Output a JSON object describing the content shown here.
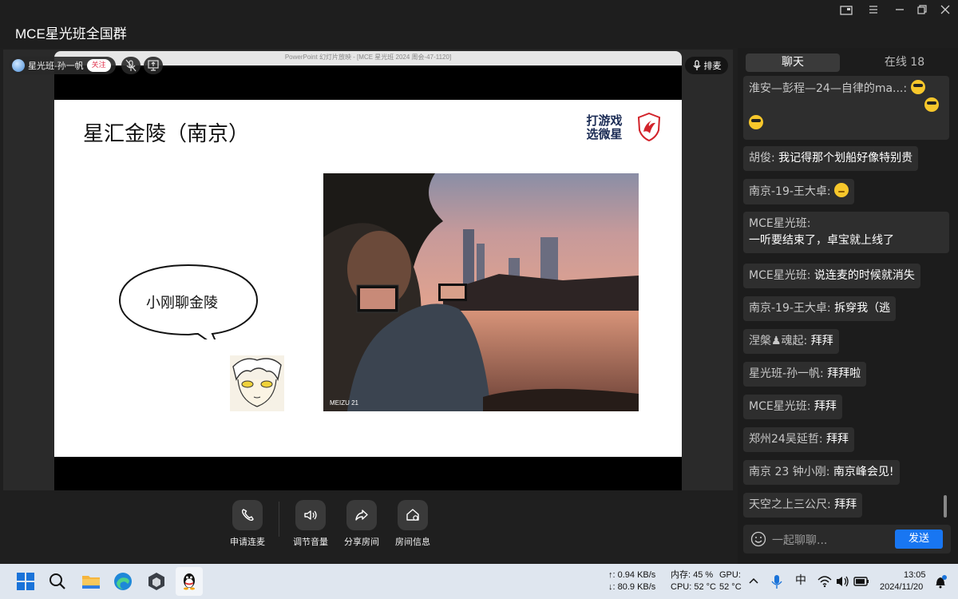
{
  "window": {
    "title": "MCE星光班全国群"
  },
  "presenter": {
    "name": "星光班-孙一帆",
    "follow_label": "关注"
  },
  "queue_label": "排麦",
  "ppt": {
    "window_title": "PowerPoint 幻灯片放映 - [MCE 星光班 2024 周会-47-1120]",
    "slide_title": "星汇金陵（南京）",
    "logo_text_line1": "打游戏",
    "logo_text_line2": "选微星",
    "bubble_text": "小刚聊金陵",
    "photo_caption": "MEIZU 21"
  },
  "controls": [
    {
      "label": "申请连麦",
      "icon": "phone-icon"
    },
    {
      "label": "调节音量",
      "icon": "speaker-icon"
    },
    {
      "label": "分享房间",
      "icon": "share-icon"
    },
    {
      "label": "房间信息",
      "icon": "house-info-icon"
    }
  ],
  "chat": {
    "tab_chat": "聊天",
    "tab_online": "在线 18",
    "messages": [
      {
        "nick": "淮安—彭程—24—自律的ma...:",
        "text": "",
        "emoji": "sunglasses"
      },
      {
        "nick": "胡俊:",
        "text": "我记得那个划船好像特别贵"
      },
      {
        "nick": "南京-19-王大卓:",
        "text": "",
        "emoji": "wink"
      },
      {
        "nick": "MCE星光班:",
        "text": "一听要结束了，卓宝就上线了"
      },
      {
        "nick": "MCE星光班:",
        "text": "说连麦的时候就消失"
      },
      {
        "nick": "南京-19-王大卓:",
        "text": "拆穿我（逃"
      },
      {
        "nick": "涅槃♟魂起:",
        "text": "拜拜"
      },
      {
        "nick": "星光班-孙一帆:",
        "text": "拜拜啦"
      },
      {
        "nick": "MCE星光班:",
        "text": "拜拜"
      },
      {
        "nick": "郑州24吴延哲:",
        "text": "拜拜"
      },
      {
        "nick": "南京 23 钟小刚:",
        "text": "南京峰会见!"
      },
      {
        "nick": "天空之上三公尺:",
        "text": "拜拜"
      }
    ],
    "input_placeholder": "一起聊聊...",
    "send_label": "发送"
  },
  "taskbar": {
    "net_up": "↑: 0.94 KB/s",
    "net_down": "↓: 80.9 KB/s",
    "mem": "内存: 45 %",
    "gpu": "GPU:",
    "cpu": "CPU: 52 °C",
    "gpu_temp": "52 °C",
    "ime": "中",
    "time": "13:05",
    "date": "2024/11/20"
  }
}
